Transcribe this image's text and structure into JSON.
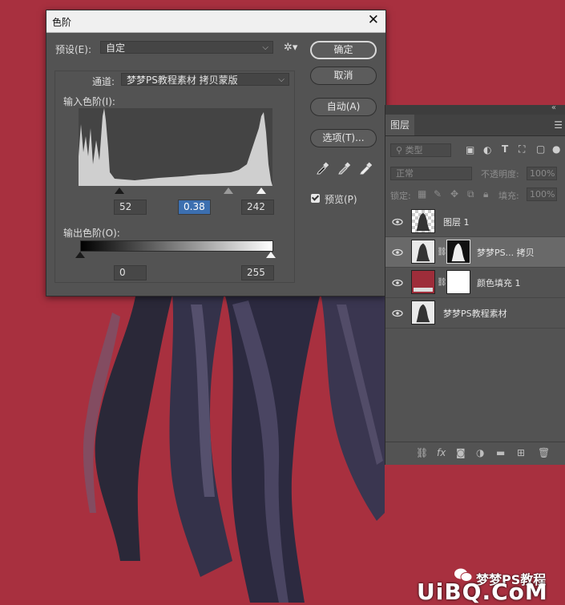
{
  "colors": {
    "canvas_background": "#a8303f",
    "dialog_bg": "#535353",
    "panel_bg": "#535353",
    "highlight_field": "#3c6fb0"
  },
  "levels_dialog": {
    "title": "色阶",
    "preset_label": "预设(E):",
    "preset_value": "自定",
    "channel_label": "通道:",
    "channel_value": "梦梦PS教程素材 拷贝蒙版",
    "input_levels_label": "输入色阶(I):",
    "input_black": "52",
    "input_gamma": "0.38",
    "input_white": "242",
    "output_levels_label": "输出色阶(O):",
    "output_black": "0",
    "output_white": "255",
    "buttons": {
      "ok": "确定",
      "cancel": "取消",
      "auto": "自动(A)",
      "options": "选项(T)..."
    },
    "preview_label": "预览(P)",
    "preview_checked": true
  },
  "layers_panel": {
    "tab_label": "图层",
    "kind_filter_placeholder": "类型",
    "blend_mode": "正常",
    "opacity_label": "不透明度:",
    "opacity_value": "100%",
    "lock_label": "锁定:",
    "fill_label": "填充:",
    "fill_value": "100%",
    "layers": [
      {
        "name": "图层 1",
        "selected": false
      },
      {
        "name": "梦梦PS... 拷贝",
        "selected": true
      },
      {
        "name": "颜色填充 1",
        "selected": false
      },
      {
        "name": "梦梦PS教程素材",
        "selected": false
      }
    ]
  },
  "watermark": {
    "text": "梦梦PS教程",
    "site": "UiBQ.CoM"
  }
}
